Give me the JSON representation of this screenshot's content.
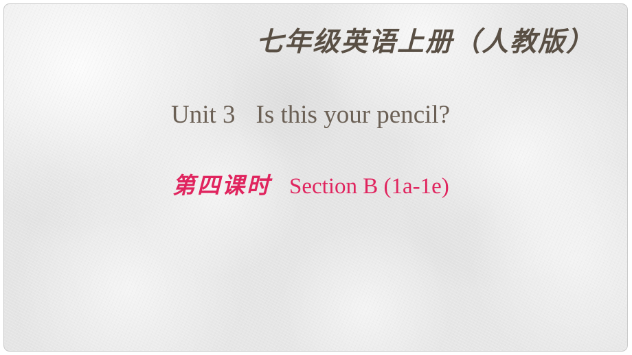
{
  "slide": {
    "background_color": "#e6e6e6",
    "canvas_color": "#ffffff",
    "border_color": "#c9c9c9",
    "header": {
      "text": "七年级英语上册（人教版）",
      "color": "#594f44"
    },
    "unit_title": {
      "unit_label": "Unit 3",
      "unit_question": "Is this your pencil?",
      "color": "#6b6055"
    },
    "period_title": {
      "period_label": "第四课时",
      "section_label": "Section B (1a-1e)",
      "color": "#e0245e"
    }
  }
}
